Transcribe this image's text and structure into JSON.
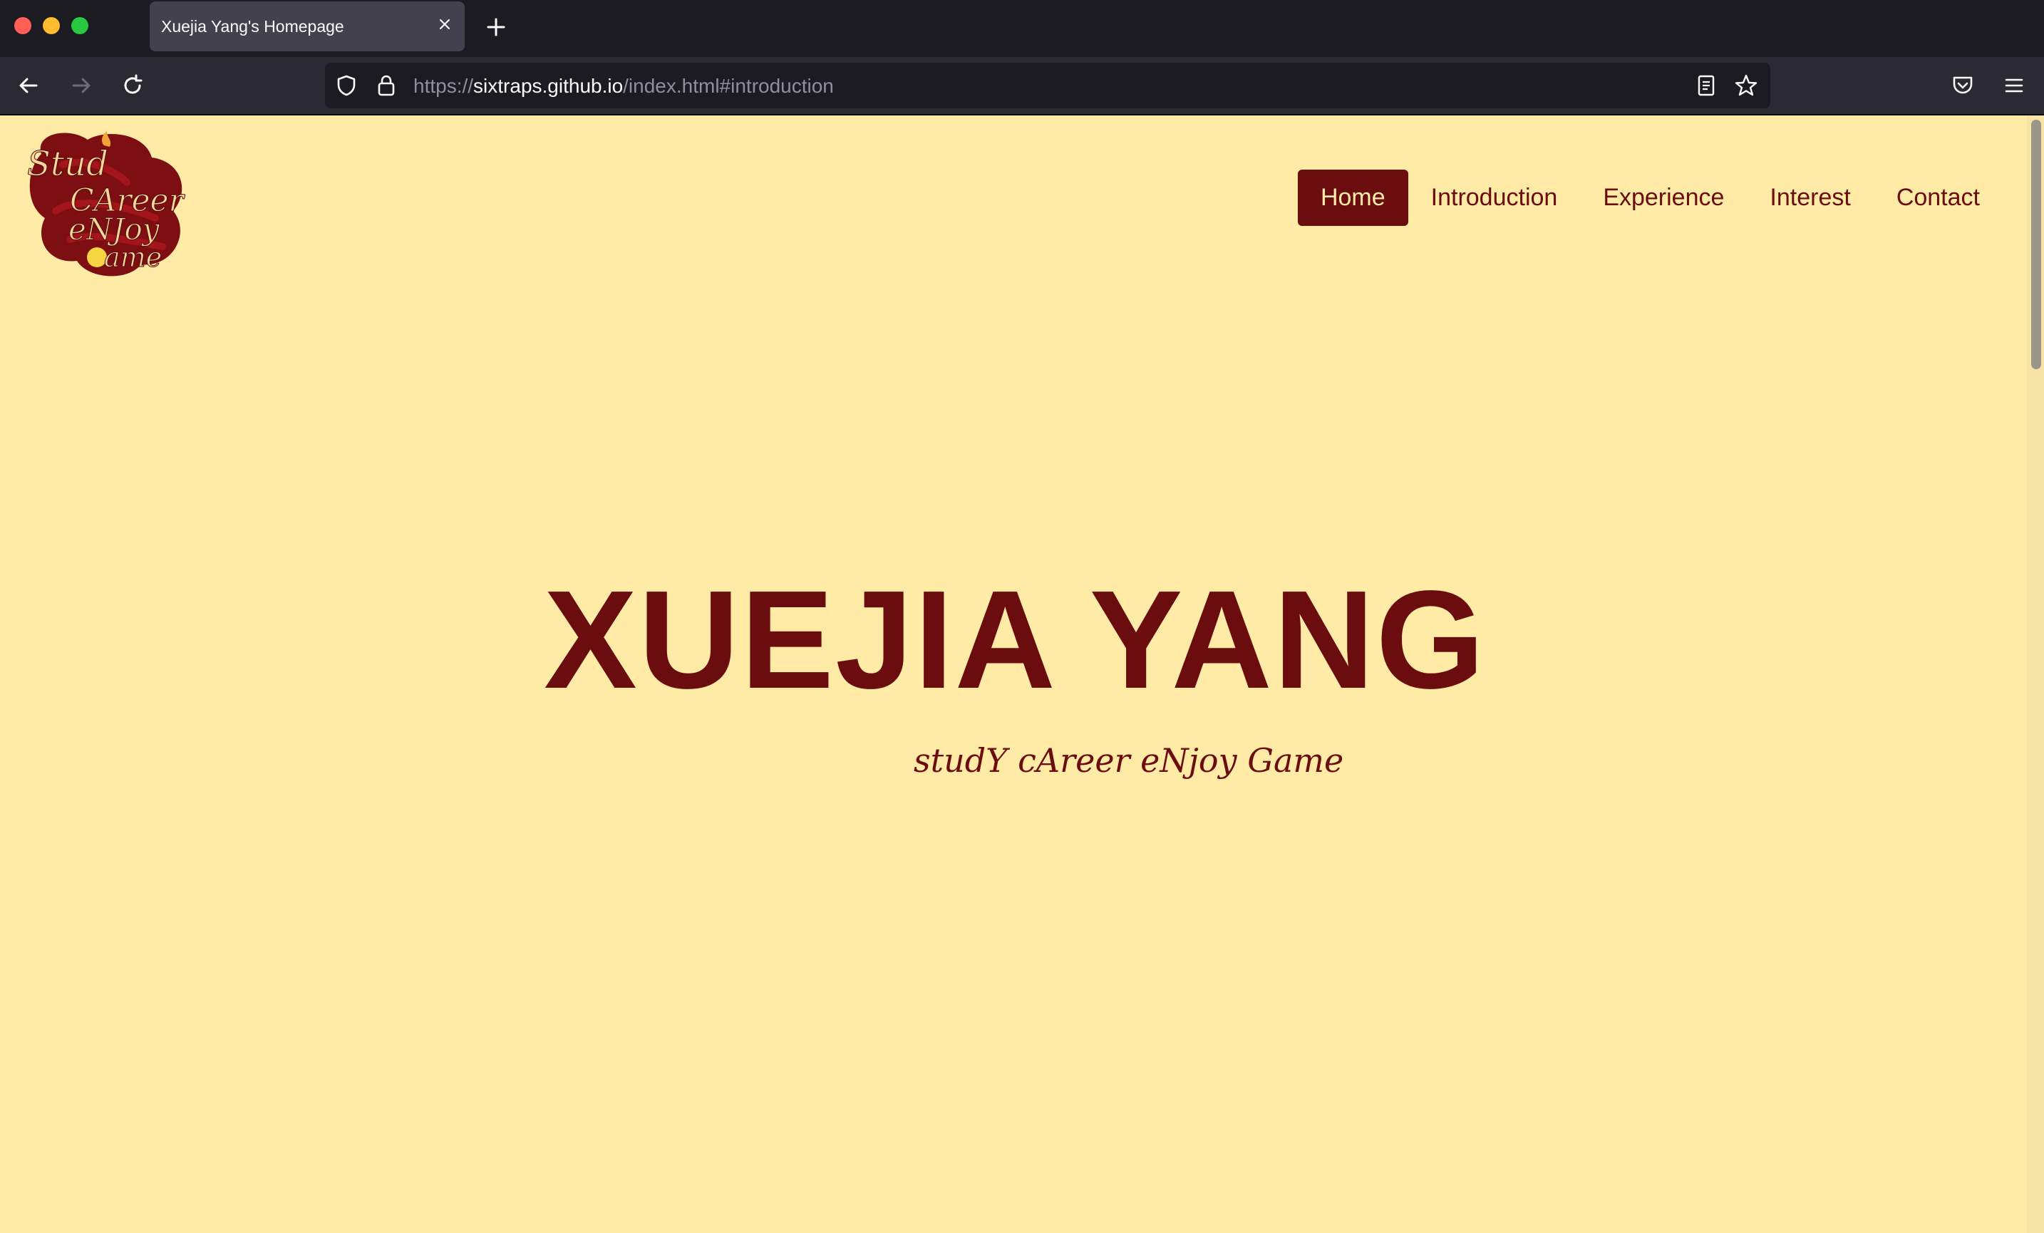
{
  "browser": {
    "tab_title": "Xuejia Yang's Homepage",
    "url_scheme": "https://",
    "url_host": "sixtraps.github.io",
    "url_path": "/index.html#introduction"
  },
  "site": {
    "nav": {
      "items": [
        {
          "label": "Home",
          "active": true
        },
        {
          "label": "Introduction",
          "active": false
        },
        {
          "label": "Experience",
          "active": false
        },
        {
          "label": "Interest",
          "active": false
        },
        {
          "label": "Contact",
          "active": false
        }
      ]
    },
    "hero": {
      "title": "XUEJIA YANG",
      "subtitle": "studY cAreer eNjoy Game"
    },
    "logo": {
      "text": "studY cAreer eNjoy Game"
    }
  },
  "colors": {
    "page_background": "#ffeba5",
    "brand": "#6b0d0f",
    "chrome_dark": "#1c1b22",
    "chrome_toolbar": "#2b2a33",
    "tab_active": "#42414d"
  }
}
